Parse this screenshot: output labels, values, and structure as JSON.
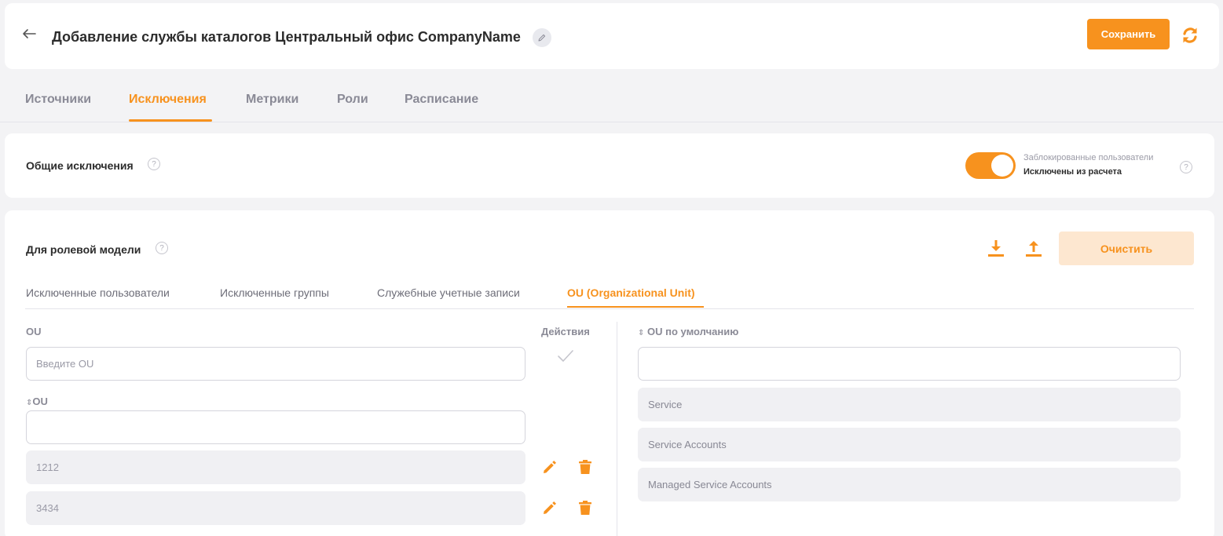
{
  "header": {
    "title": "Добавление службы каталогов Центральный офис CompanyName",
    "save_label": "Сохранить"
  },
  "tabs": [
    {
      "label": "Источники",
      "active": false
    },
    {
      "label": "Исключения",
      "active": true
    },
    {
      "label": "Метрики",
      "active": false
    },
    {
      "label": "Роли",
      "active": false
    },
    {
      "label": "Расписание",
      "active": false
    }
  ],
  "general": {
    "title": "Общие исключения",
    "toggle_on": true,
    "toggle_caption": "Заблокированные пользователи",
    "toggle_value": "Исключены из расчета"
  },
  "role_model": {
    "title": "Для ролевой модели",
    "clear_label": "Очистить",
    "subtabs": [
      {
        "label": "Исключенные пользователи",
        "active": false
      },
      {
        "label": "Исключенные группы",
        "active": false
      },
      {
        "label": "Служебные учетные записи",
        "active": false
      },
      {
        "label": "OU (Organizational Unit)",
        "active": true
      }
    ],
    "left": {
      "ou_label": "OU",
      "actions_label": "Действия",
      "ou_placeholder": "Введите OU",
      "sort_label": "OU",
      "filter_value": "",
      "rows": [
        "1212",
        "3434"
      ]
    },
    "right": {
      "sort_label": "OU по умолчанию",
      "filter_value": "",
      "rows": [
        "Service",
        "Service Accounts",
        "Managed Service Accounts"
      ]
    }
  },
  "colors": {
    "accent": "#f7921e",
    "accent_light": "#fde7d0",
    "background": "#f3f3f5"
  }
}
